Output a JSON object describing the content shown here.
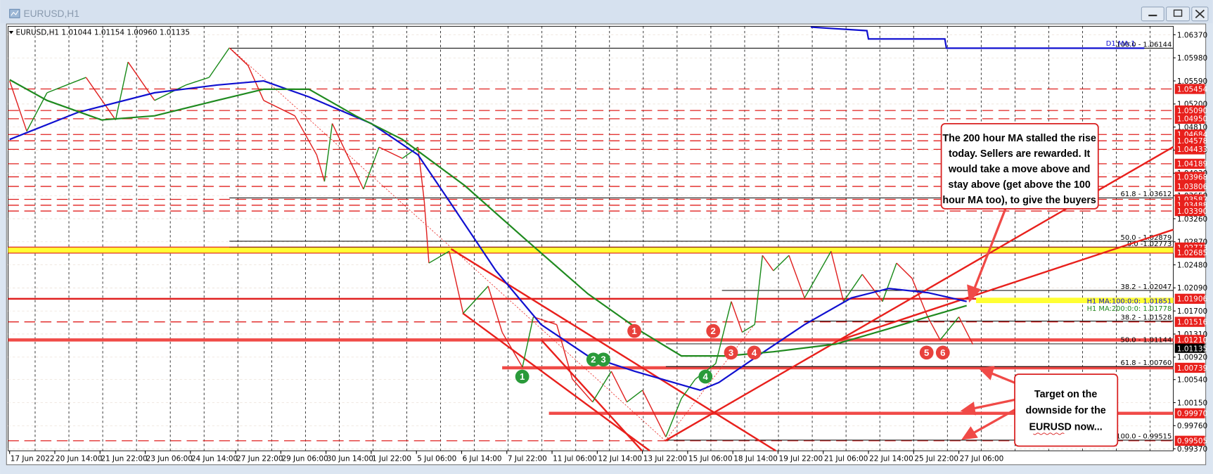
{
  "window": {
    "title": "EURUSD,H1",
    "minimize_icon": "minimize-icon",
    "maximize_icon": "restore-icon",
    "close_icon": "close-icon"
  },
  "chart_data": {
    "type": "line",
    "title": "EURUSD,H1",
    "ohlc_readout": "EURUSD,H1  1.01044 1.01154 1.00960 1.01135",
    "xlabel": "",
    "ylabel": "",
    "ylim": [
      0.9937,
      1.0637
    ],
    "grid": true,
    "x_unit": "H1 bar index",
    "x_tick_labels": [
      "17 Jun 2022",
      "20 Jun 14:00",
      "21 Jun 22:00",
      "23 Jun 06:00",
      "24 Jun 14:00",
      "27 Jun 22:00",
      "29 Jun 06:00",
      "30 Jun 14:00",
      "1 Jul 22:00",
      "5 Jul 06:00",
      "6 Jul 14:00",
      "7 Jul 22:00",
      "11 Jul 06:00",
      "12 Jul 14:00",
      "13 Jul 22:00",
      "15 Jul 06:00",
      "18 Jul 14:00",
      "19 Jul 22:00",
      "21 Jul 06:00",
      "22 Jul 14:00",
      "25 Jul 22:00",
      "27 Jul 06:00"
    ],
    "x_tick_step_bars": 29,
    "y_ticks": [
      "1.06370",
      "1.05980",
      "1.05590",
      "1.05200",
      "1.04810",
      "1.04420",
      "1.04030",
      "1.03650",
      "1.03260",
      "1.02870",
      "1.02480",
      "1.02090",
      "1.01700",
      "1.01310",
      "1.00920",
      "1.00540",
      "1.00150",
      "0.99760",
      "0.99370"
    ],
    "current_price": "1.01135",
    "series": [
      {
        "name": "EURUSD price",
        "color": "#1a8a1a",
        "down_color": "#e0201f",
        "points": [
          [
            0,
            1.0559
          ],
          [
            11,
            1.0474
          ],
          [
            24,
            1.0539
          ],
          [
            49,
            1.0565
          ],
          [
            68,
            1.0493
          ],
          [
            76,
            1.0591
          ],
          [
            93,
            1.0526
          ],
          [
            113,
            1.0552
          ],
          [
            128,
            1.0565
          ],
          [
            141,
            1.0615
          ],
          [
            153,
            1.0585
          ],
          [
            163,
            1.0526
          ],
          [
            183,
            1.05
          ],
          [
            197,
            1.0434
          ],
          [
            202,
            1.0389
          ],
          [
            207,
            1.0487
          ],
          [
            227,
            1.0376
          ],
          [
            237,
            1.0447
          ],
          [
            252,
            1.0428
          ],
          [
            262,
            1.0447
          ],
          [
            266,
            1.0356
          ],
          [
            269,
            1.0251
          ],
          [
            282,
            1.0271
          ],
          [
            291,
            1.0166
          ],
          [
            307,
            1.0212
          ],
          [
            316,
            1.0134
          ],
          [
            329,
            1.0075
          ],
          [
            336,
            1.016
          ],
          [
            351,
            1.0147
          ],
          [
            361,
            1.0055
          ],
          [
            374,
            1.0016
          ],
          [
            386,
            1.0068
          ],
          [
            396,
            1.0016
          ],
          [
            406,
            1.0036
          ],
          [
            421,
            0.9957
          ],
          [
            431,
            1.0022
          ],
          [
            440,
            1.0055
          ],
          [
            453,
            1.0081
          ],
          [
            463,
            1.0186
          ],
          [
            470,
            1.0134
          ],
          [
            478,
            1.0147
          ],
          [
            483,
            1.0264
          ],
          [
            490,
            1.0238
          ],
          [
            500,
            1.0264
          ],
          [
            510,
            1.0192
          ],
          [
            527,
            1.0271
          ],
          [
            535,
            1.0186
          ],
          [
            547,
            1.0232
          ],
          [
            560,
            1.0186
          ],
          [
            569,
            1.0251
          ],
          [
            579,
            1.0225
          ],
          [
            589,
            1.016
          ],
          [
            597,
            1.0121
          ],
          [
            609,
            1.016
          ],
          [
            618,
            1.01135
          ]
        ]
      },
      {
        "name": "H1 MA 100",
        "color": "#1010d0",
        "points": [
          [
            0,
            1.046
          ],
          [
            44,
            1.0506
          ],
          [
            93,
            1.0539
          ],
          [
            133,
            1.0552
          ],
          [
            163,
            1.0559
          ],
          [
            192,
            1.0532
          ],
          [
            232,
            1.0487
          ],
          [
            262,
            1.0434
          ],
          [
            282,
            1.0356
          ],
          [
            312,
            1.0238
          ],
          [
            341,
            1.0147
          ],
          [
            371,
            1.0094
          ],
          [
            401,
            1.0068
          ],
          [
            426,
            1.0049
          ],
          [
            443,
            1.0036
          ],
          [
            455,
            1.0049
          ],
          [
            480,
            1.0094
          ],
          [
            510,
            1.0147
          ],
          [
            540,
            1.0192
          ],
          [
            564,
            1.0208
          ],
          [
            589,
            1.0201
          ],
          [
            614,
            1.0186
          ]
        ]
      },
      {
        "name": "H1 MA 200",
        "color": "#1f8a1f",
        "points": [
          [
            0,
            1.0561
          ],
          [
            24,
            1.0526
          ],
          [
            59,
            1.0493
          ],
          [
            93,
            1.05
          ],
          [
            133,
            1.0526
          ],
          [
            163,
            1.0545
          ],
          [
            192,
            1.0545
          ],
          [
            222,
            1.05
          ],
          [
            252,
            1.046
          ],
          [
            292,
            1.0382
          ],
          [
            331,
            1.0291
          ],
          [
            371,
            1.0199
          ],
          [
            406,
            1.0134
          ],
          [
            431,
            1.0094
          ],
          [
            460,
            1.0094
          ],
          [
            490,
            1.0101
          ],
          [
            530,
            1.0114
          ],
          [
            564,
            1.014
          ],
          [
            589,
            1.016
          ],
          [
            614,
            1.0179
          ]
        ]
      },
      {
        "name": "D1 MA 100",
        "color": "#1010d0",
        "points": [
          [
            514,
            1.065
          ],
          [
            550,
            1.0644
          ],
          [
            551,
            1.063
          ],
          [
            600,
            1.063
          ],
          [
            601,
            1.06144
          ],
          [
            728,
            1.06144
          ]
        ]
      }
    ],
    "levels": [
      {
        "price": 1.05454,
        "label": "1.05454",
        "style": "dashed"
      },
      {
        "price": 1.0509,
        "label": "1.05090",
        "style": "dashed"
      },
      {
        "price": 1.0495,
        "label": "1.04950",
        "style": "dashed"
      },
      {
        "price": 1.04684,
        "label": "1.04684",
        "style": "dashed"
      },
      {
        "price": 1.04578,
        "label": "1.04578",
        "style": "dashed"
      },
      {
        "price": 1.04433,
        "label": "1.04433",
        "style": "dashed"
      },
      {
        "price": 1.04189,
        "label": "1.04189",
        "style": "dashed"
      },
      {
        "price": 1.03968,
        "label": "1.03968",
        "style": "dashed"
      },
      {
        "price": 1.03806,
        "label": "1.03806",
        "style": "dashed"
      },
      {
        "price": 1.03587,
        "label": "1.03587",
        "style": "dashed"
      },
      {
        "price": 1.03488,
        "label": "1.03488",
        "style": "dashed"
      },
      {
        "price": 1.0339,
        "label": "1.03390",
        "style": "dashed"
      },
      {
        "price": 1.02773,
        "label": "1.02773",
        "style": "solid"
      },
      {
        "price": 1.02685,
        "label": "1.02685",
        "style": "solid"
      },
      {
        "price": 1.01906,
        "label": "1.01906",
        "style": "solid"
      },
      {
        "price": 1.01516,
        "label": "1.01516",
        "style": "dashed"
      },
      {
        "price": 1.0121,
        "label": "1.01210",
        "style": "thick"
      },
      {
        "price": 1.00739,
        "label": "1.00739",
        "style": "thick",
        "start_bar": 316
      },
      {
        "price": 0.9997,
        "label": "0.99970",
        "style": "thick",
        "start_bar": 346
      },
      {
        "price": 0.99505,
        "label": "0.99505",
        "style": "dashed"
      }
    ],
    "fib_labels": [
      {
        "price": 1.06144,
        "label": "100.0 - 1.06144",
        "start_bar": 141
      },
      {
        "price": 1.03612,
        "label": "61.8 - 1.03612",
        "start_bar": 141
      },
      {
        "price": 1.02879,
        "label": "50.0 - 1.02879",
        "start_bar": 141
      },
      {
        "price": 1.02773,
        "label": "0.0 -1.02773",
        "start_bar": 141
      },
      {
        "price": 1.02047,
        "label": "38.2 - 1.02047",
        "start_bar": 457
      },
      {
        "price": 1.01528,
        "label": "38.2 - 1.01528",
        "start_bar": 510
      },
      {
        "price": 1.01144,
        "label": "50.0 - 1.01144",
        "start_bar": 421
      },
      {
        "price": 1.0076,
        "label": "61.8 - 1.00760",
        "start_bar": 421
      },
      {
        "price": 0.99515,
        "label": "100.0 - 0.99515",
        "start_bar": 421
      }
    ],
    "ma_labels": [
      {
        "label": "D1 MA:1",
        "color": "#1010d0"
      },
      {
        "label": "H1 MA:100:0:0: 1.01851",
        "color": "#1010d0"
      },
      {
        "label": "H1 MA:200:0:0: 1.01778",
        "color": "#1f8a1f"
      }
    ],
    "markers": {
      "red": [
        "1",
        "2",
        "3",
        "4",
        "5",
        "6"
      ],
      "green": [
        "1",
        "2",
        "3",
        "4"
      ]
    },
    "annotations": {
      "ma_note": [
        "The 200 hour MA stalled the rise",
        "today. Sellers are rewarded. It",
        "would take a move above and",
        "stay above (get above the 100",
        "hour MA too), to give the buyers"
      ],
      "target_note": [
        "Target on the",
        "downside for the",
        "EURUSD now..."
      ]
    },
    "colors": {
      "level": "#e0201f",
      "band": "#ffff33",
      "marker_red": "#e8413c",
      "marker_green": "#2a9a3a"
    }
  }
}
